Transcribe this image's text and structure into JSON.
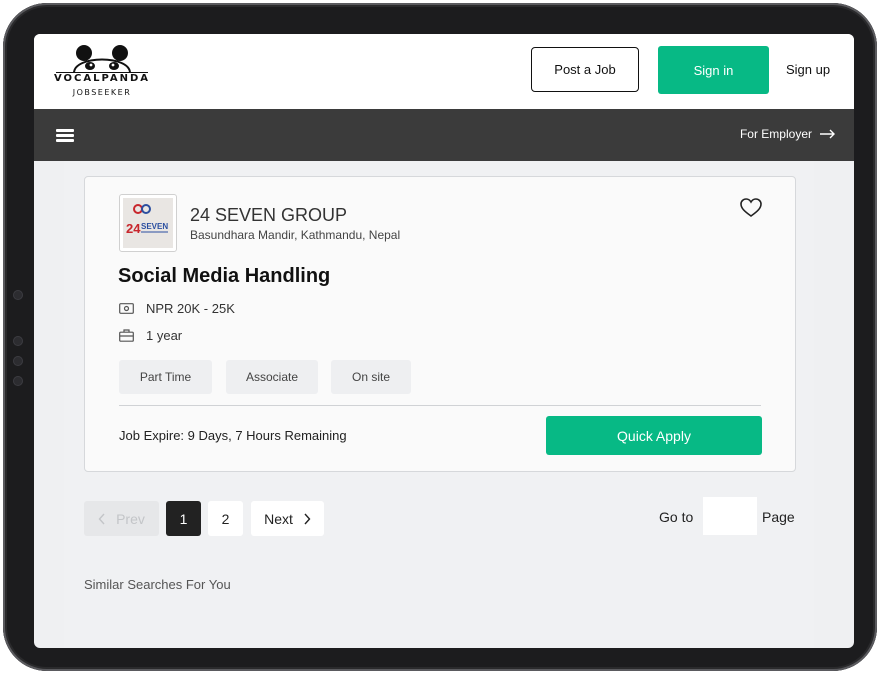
{
  "header": {
    "logo_text": "VOCALPANDA",
    "logo_sub": "JOBSEEKER",
    "post_job_label": "Post a Job",
    "sign_in_label": "Sign in",
    "sign_up_label": "Sign up"
  },
  "navbar": {
    "for_employer_label": "For Employer"
  },
  "job_card": {
    "company_name": "24 SEVEN GROUP",
    "company_location": "Basundhara Mandir, Kathmandu, Nepal",
    "company_logo_text": "24 SEVEN",
    "job_title": "Social Media Handling",
    "salary": "NPR 20K - 25K",
    "experience": "1 year",
    "tags": [
      "Part Time",
      "Associate",
      "On site"
    ],
    "expiry": "Job Expire: 9 Days, 7 Hours Remaining",
    "quick_apply_label": "Quick Apply"
  },
  "pagination": {
    "prev_label": "Prev",
    "pages": [
      "1",
      "2"
    ],
    "next_label": "Next",
    "goto_label": "Go to",
    "page_label": "Page",
    "goto_value": ""
  },
  "similar_searches_label": "Similar Searches For You",
  "colors": {
    "accent": "#07b985",
    "navbar": "#3b3b3b",
    "background": "#eff0f2"
  }
}
